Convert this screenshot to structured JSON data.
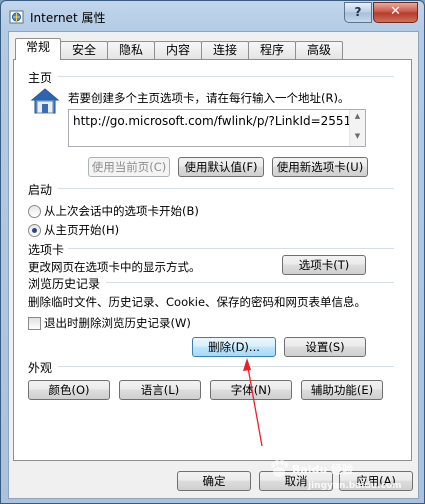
{
  "window": {
    "title": "Internet 属性",
    "help_label": "?",
    "close_label": "✕"
  },
  "tabs": [
    {
      "label": "常规",
      "active": true
    },
    {
      "label": "安全"
    },
    {
      "label": "隐私"
    },
    {
      "label": "内容"
    },
    {
      "label": "连接"
    },
    {
      "label": "程序"
    },
    {
      "label": "高级"
    }
  ],
  "homepage": {
    "group_title": "主页",
    "description": "若要创建多个主页选项卡，请在每行输入一个地址(R)。",
    "url": "http://go.microsoft.com/fwlink/p/?LinkId=2551",
    "icon": "house-icon",
    "buttons": {
      "use_current": "使用当前页(C)",
      "use_default": "使用默认值(F)",
      "use_new_tab": "使用新选项卡(U)"
    }
  },
  "startup": {
    "group_title": "启动",
    "options": [
      {
        "label": "从上次会话中的选项卡开始(B)",
        "checked": false
      },
      {
        "label": "从主页开始(H)",
        "checked": true
      }
    ]
  },
  "tabs_section": {
    "group_title": "选项卡",
    "description": "更改网页在选项卡中的显示方式。",
    "button": "选项卡(T)"
  },
  "history": {
    "group_title": "浏览历史记录",
    "description": "删除临时文件、历史记录、Cookie、保存的密码和网页表单信息。",
    "checkbox_label": "退出时删除浏览历史记录(W)",
    "checkbox_checked": false,
    "delete_button": "删除(D)...",
    "settings_button": "设置(S)"
  },
  "appearance": {
    "group_title": "外观",
    "buttons": [
      "颜色(O)",
      "语言(L)",
      "字体(N)",
      "辅助功能(E)"
    ]
  },
  "footer": {
    "ok": "确定",
    "cancel": "取消",
    "apply": "应用(A)"
  },
  "annotation": {
    "arrow_color": "#e8222b"
  },
  "watermark": {
    "text": "Baidu 经验",
    "url": "jingyan.baidu.com"
  }
}
